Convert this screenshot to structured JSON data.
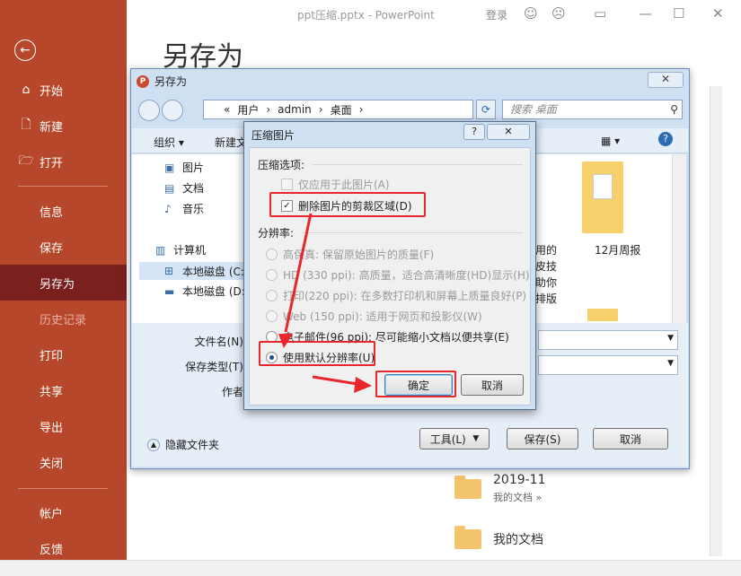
{
  "app": {
    "window_title": "ppt压缩.pptx  -  PowerPoint",
    "login": "登录",
    "page_title": "另存为"
  },
  "sidebar": {
    "items": [
      {
        "label": "开始",
        "icon": "home-icon"
      },
      {
        "label": "新建",
        "icon": "new-doc-icon"
      },
      {
        "label": "打开",
        "icon": "folder-open-icon"
      },
      {
        "label": "信息"
      },
      {
        "label": "保存"
      },
      {
        "label": "另存为"
      },
      {
        "label": "历史记录"
      },
      {
        "label": "打印"
      },
      {
        "label": "共享"
      },
      {
        "label": "导出"
      },
      {
        "label": "关闭"
      },
      {
        "label": "帐户"
      },
      {
        "label": "反馈"
      }
    ]
  },
  "recent": [
    {
      "name": "2019-11",
      "path": "我的文档 »"
    },
    {
      "name": "我的文档",
      "path": ""
    }
  ],
  "saveas": {
    "title": "另存为",
    "address": [
      "«",
      "用户",
      "›",
      "admin",
      "›",
      "桌面",
      "›"
    ],
    "search_placeholder": "搜索 桌面",
    "toolbar": {
      "organize": "组织 ▾",
      "new_folder": "新建文"
    },
    "nav": {
      "pictures": "图片",
      "documents": "文档",
      "music": "音乐",
      "computer": "计算机",
      "disk_c": "本地磁盘 (C:",
      "disk_d": "本地磁盘 (D:"
    },
    "files": {
      "weekly_report": "12月周报",
      "partial_lines": [
        "用的",
        "皮技",
        "助你",
        "排版"
      ]
    },
    "labels": {
      "filename": "文件名(N):",
      "filetype": "保存类型(T):",
      "author": "作者:"
    },
    "hide_folders": "隐藏文件夹",
    "buttons": {
      "tools": "工具(L)",
      "save": "保存(S)",
      "cancel": "取消"
    }
  },
  "compress": {
    "title": "压缩图片",
    "help": "?",
    "close": "✕",
    "section_options": "压缩选项:",
    "opt_apply_only": "仅应用于此图片(A)",
    "opt_delete_crop": "删除图片的剪裁区域(D)",
    "section_resolution": "分辨率:",
    "res": [
      {
        "label": "高保真: 保留原始图片的质量(F)",
        "enabled": false
      },
      {
        "label": "HD (330 ppi): 高质量，适合高清晰度(HD)显示(H)",
        "enabled": false
      },
      {
        "label": "打印(220 ppi): 在多数打印机和屏幕上质量良好(P)",
        "enabled": false
      },
      {
        "label": "Web (150 ppi): 适用于网页和投影仪(W)",
        "enabled": false
      },
      {
        "label": "电子邮件(96 ppi): 尽可能缩小文档以便共享(E)",
        "enabled": true
      },
      {
        "label": "使用默认分辨率(U)",
        "enabled": true,
        "selected": true
      }
    ],
    "ok": "确定",
    "cancel": "取消"
  },
  "colors": {
    "backstage": "#b7472a",
    "active_item": "#7b1f1f",
    "highlight": "#e8262b"
  }
}
